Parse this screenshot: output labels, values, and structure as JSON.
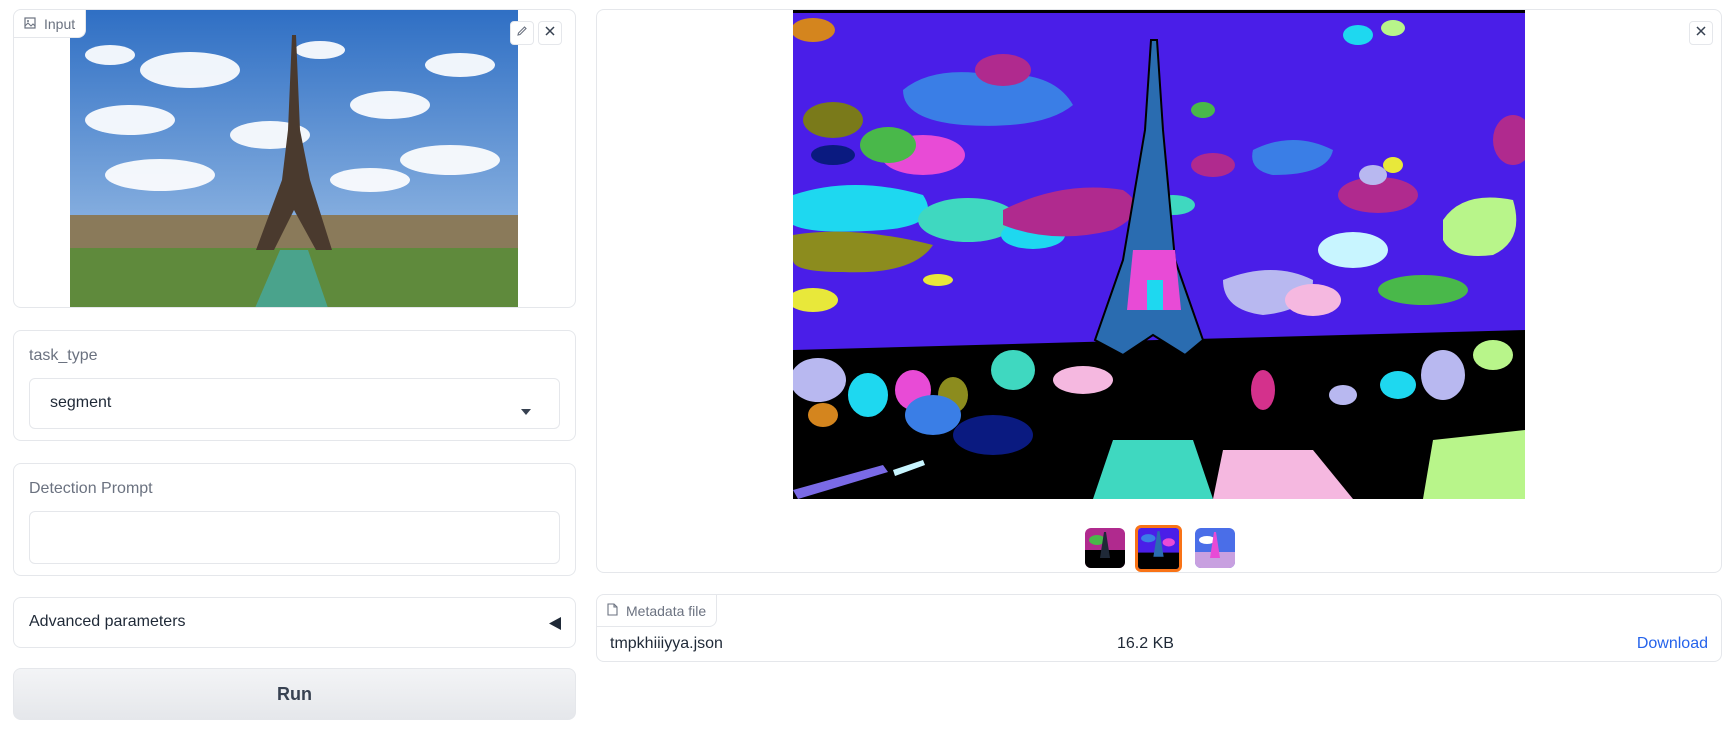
{
  "input": {
    "label": "Input"
  },
  "task_type": {
    "label": "task_type",
    "value": "segment"
  },
  "detection_prompt": {
    "label": "Detection Prompt",
    "value": ""
  },
  "advanced": {
    "label": "Advanced parameters"
  },
  "run": {
    "label": "Run"
  },
  "metadata": {
    "label": "Metadata file",
    "filename": "tmpkhiiiyya.json",
    "size": "16.2 KB",
    "download": "Download"
  },
  "colors": {
    "accent": "#f97316",
    "link": "#2563eb",
    "seg_background": "#4a1ee8"
  }
}
